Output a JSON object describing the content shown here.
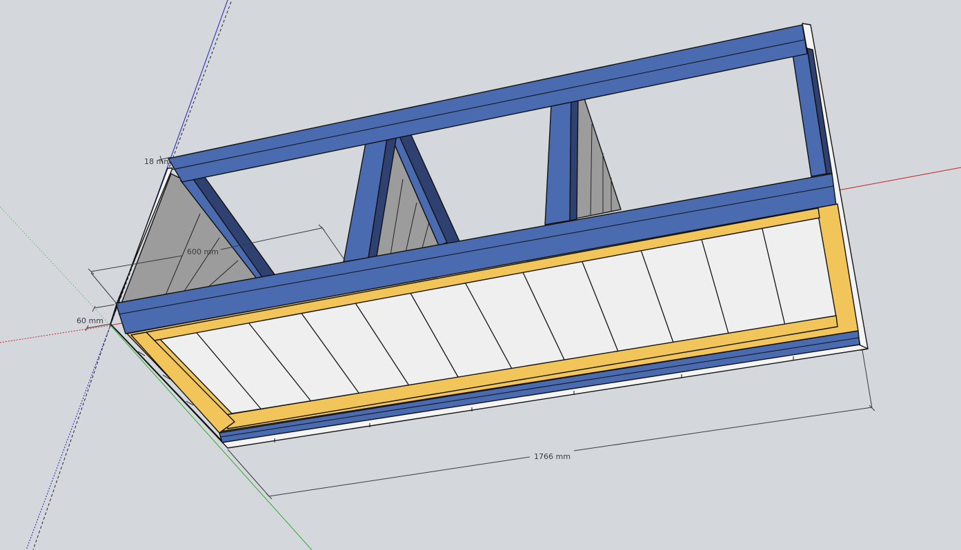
{
  "viewport": {
    "background_color": "#d4d8dc",
    "colors": {
      "frame_blue": "#4a6bb0",
      "frame_blue_dark": "#2e4170",
      "rail_yellow": "#f2c55a",
      "slat_white": "#efefef",
      "panel_gray": "#9c9c9c",
      "axis_red": "#cc1f1f",
      "axis_green": "#2eaa2e",
      "axis_blue": "#1f1fcc"
    }
  },
  "dimensions": {
    "top_board": "18 mm",
    "depth": "600 mm",
    "rail_height": "60 mm",
    "length": "1766 mm"
  }
}
